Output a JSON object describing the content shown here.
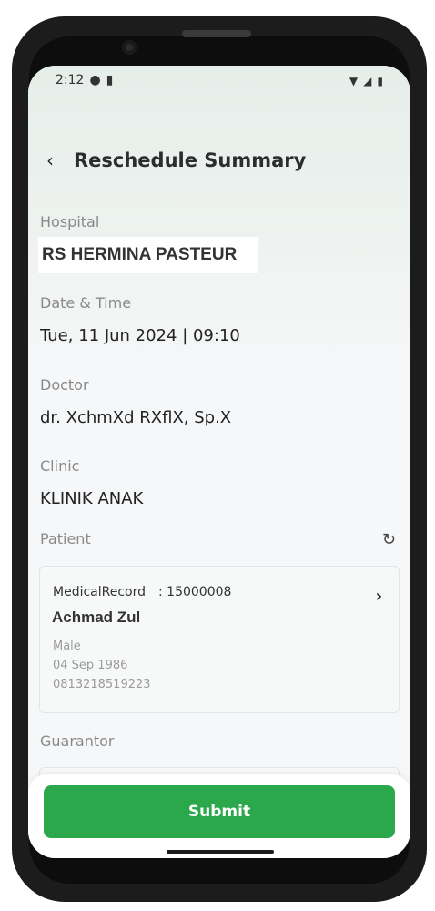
{
  "status_bar": {
    "time": "2:12"
  },
  "header": {
    "title": "Reschedule Summary"
  },
  "hospital": {
    "label": "Hospital",
    "value": "RS HERMINA PASTEUR"
  },
  "datetime": {
    "label": "Date & Time",
    "value": "Tue, 11 Jun 2024 | 09:10"
  },
  "doctor": {
    "label": "Doctor",
    "value": "dr. XchmXd RXflX, Sp.X"
  },
  "clinic": {
    "label": "Clinic",
    "value": "KLINIK ANAK"
  },
  "patient": {
    "label": "Patient",
    "medical_record_label": "MedicalRecord",
    "medical_record_value": ": 15000008",
    "name": "Achmad Zul",
    "gender": "Male",
    "birth_date": "04 Sep 1986",
    "phone": "0813218519223"
  },
  "guarantor": {
    "label": "Guarantor"
  },
  "footer": {
    "submit_label": "Submit"
  },
  "colors": {
    "accent": "#2ba74c"
  }
}
